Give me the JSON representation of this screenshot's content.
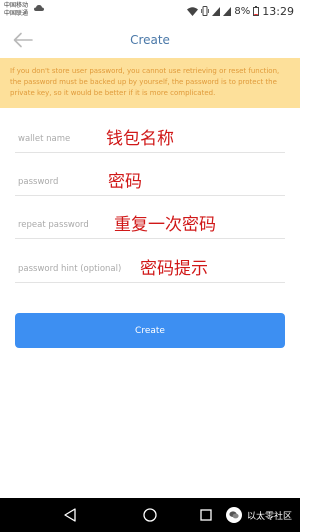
{
  "status_bar": {
    "carrier_1": "中国移动",
    "carrier_2": "中国联通",
    "battery": "8%",
    "time": "13:29"
  },
  "header": {
    "title": "Create"
  },
  "warning": {
    "text": "If you don't store user password, you cannot use retrieving or reset function, the password must be backed up by yourself, the password is to protect the private key, so it would be better if it is more complicated."
  },
  "form": {
    "wallet_name_placeholder": "wallet name",
    "wallet_name_annotation": "钱包名称",
    "password_placeholder": "password",
    "password_annotation": "密码",
    "repeat_password_placeholder": "repeat password",
    "repeat_password_annotation": "重复一次密码",
    "password_hint_placeholder": "password hint (optional)",
    "password_hint_annotation": "密码提示"
  },
  "create_button": {
    "label": "Create"
  },
  "watermark": {
    "text": "以太零社区"
  },
  "colors": {
    "title": "#4a78a8",
    "warning_bg": "#fde09a",
    "warning_text": "#e09a3a",
    "button": "#3d8ff2",
    "annotation": "#d01818"
  }
}
